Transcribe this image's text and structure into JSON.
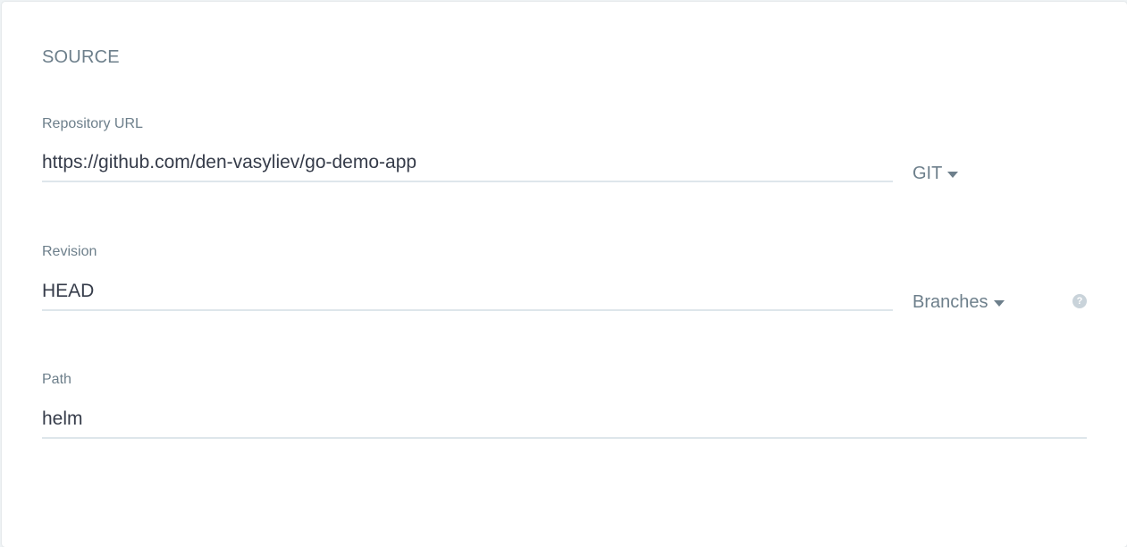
{
  "section": {
    "title": "SOURCE"
  },
  "fields": {
    "repo_url": {
      "label": "Repository URL",
      "value": "https://github.com/den-vasyliev/go-demo-app"
    },
    "revision": {
      "label": "Revision",
      "value": "HEAD"
    },
    "path": {
      "label": "Path",
      "value": "helm"
    }
  },
  "dropdowns": {
    "repo_type": "GIT",
    "revision_type": "Branches"
  },
  "help_icon": {
    "glyph": "?",
    "icon": "question-circle-icon"
  },
  "colors": {
    "label": "#6d7f8b",
    "text": "#363c4a",
    "underline": "#dee6eb",
    "help_icon": "#c9d3da"
  }
}
